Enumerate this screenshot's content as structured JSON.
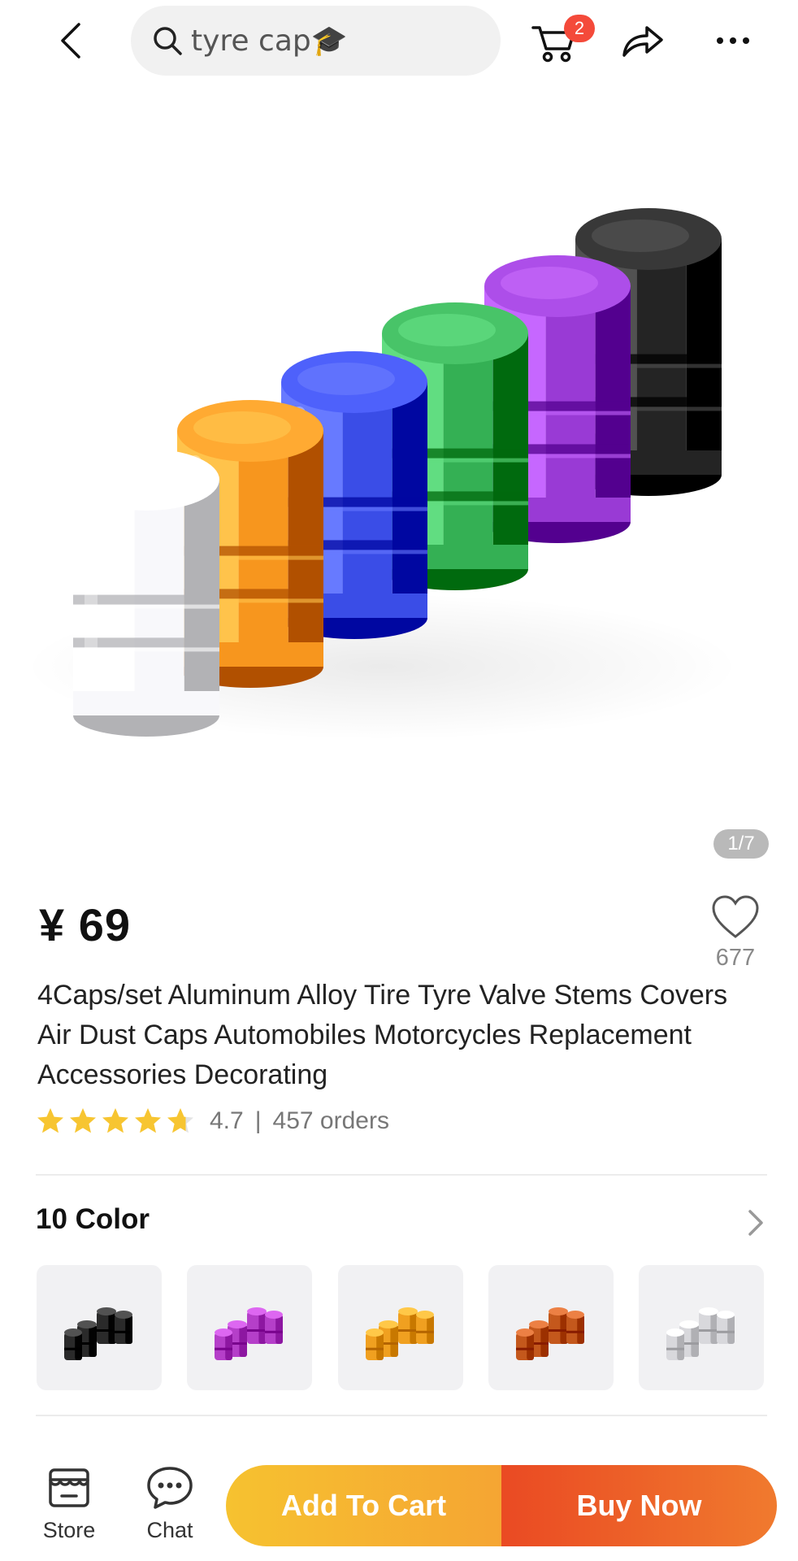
{
  "header": {
    "search_query": "tyre cap",
    "search_emoji": "🎓",
    "cart_badge": "2",
    "icons": [
      "back-arrow-icon",
      "search-icon",
      "cart-icon",
      "share-icon",
      "more-icon"
    ]
  },
  "gallery": {
    "indicator": "1/7",
    "current_index": 1,
    "total_images": 7,
    "cap_colors": [
      "#e9e9ec",
      "#e8870f",
      "#2b3ed8",
      "#25a145",
      "#8a2bc6",
      "#151515"
    ]
  },
  "product": {
    "price": "¥ 69",
    "wishlist_count": "677",
    "title": "4Caps/set Aluminum Alloy Tire Tyre Valve Stems Covers Air Dust Caps Automobiles Motorcycles Replacement Accessories Decorating",
    "rating": "4.7",
    "rating_separator": "|",
    "stars_value": 4.7,
    "orders": "457 orders"
  },
  "variants": {
    "header": "10 Color",
    "swatch_colors": [
      "#2a2a2a",
      "#b53fc9",
      "#f0a020",
      "#c4581c",
      "#d8d8dc"
    ]
  },
  "bottom_bar": {
    "store_label": "Store",
    "chat_label": "Chat",
    "add_to_cart_label": "Add To Cart",
    "buy_now_label": "Buy Now",
    "colors": {
      "add_to_cart": "#f5b031",
      "buy_now": "#ec5a26",
      "badge": "#f44a3a",
      "star": "#f7c531"
    }
  }
}
